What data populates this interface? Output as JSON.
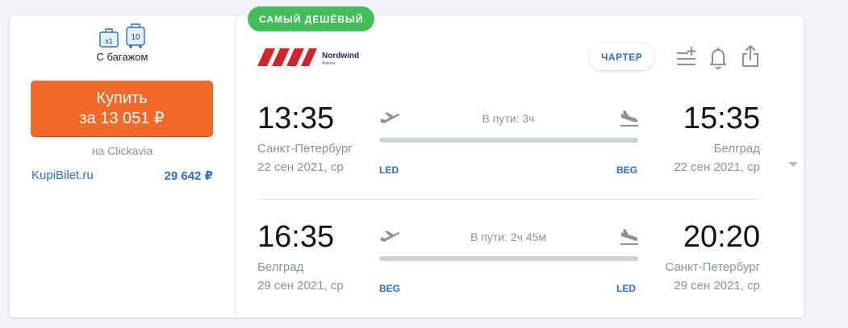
{
  "colors": {
    "accent_orange": "#f2692a",
    "badge_green": "#43bd5a",
    "link_blue": "#2e6fc7",
    "muted_text": "#8a939d",
    "logo_red": "#d4242b"
  },
  "offer": {
    "badge": "САМЫЙ ДЕШЁВЫЙ",
    "baggage": {
      "hand_count": "x1",
      "checked_weight": "10",
      "label": "С багажом"
    },
    "buy_button": {
      "line1": "Купить",
      "line2": "за 13 051 ₽"
    },
    "seller": "на Clickavia",
    "alternative": {
      "name": "KupiBilet.ru",
      "price": "29 642 ₽"
    }
  },
  "airline": {
    "name": "Nordwind",
    "sub": "Airlines"
  },
  "tag": "ЧАРТЕР",
  "actions": {
    "icons": [
      "add-to-list-icon",
      "bell-icon",
      "share-icon"
    ]
  },
  "segments": [
    {
      "dep_time": "13:35",
      "dep_city": "Санкт-Петербург",
      "dep_date": "22 сен 2021, ср",
      "dep_code": "LED",
      "arr_time": "15:35",
      "arr_city": "Белград",
      "arr_date": "22 сен 2021, ср",
      "arr_code": "BEG",
      "duration": "В пути: 3ч"
    },
    {
      "dep_time": "16:35",
      "dep_city": "Белград",
      "dep_date": "29 сен 2021, ср",
      "dep_code": "BEG",
      "arr_time": "20:20",
      "arr_city": "Санкт-Петербург",
      "arr_date": "29 сен 2021, ср",
      "arr_code": "LED",
      "duration": "В пути: 2ч 45м"
    }
  ]
}
